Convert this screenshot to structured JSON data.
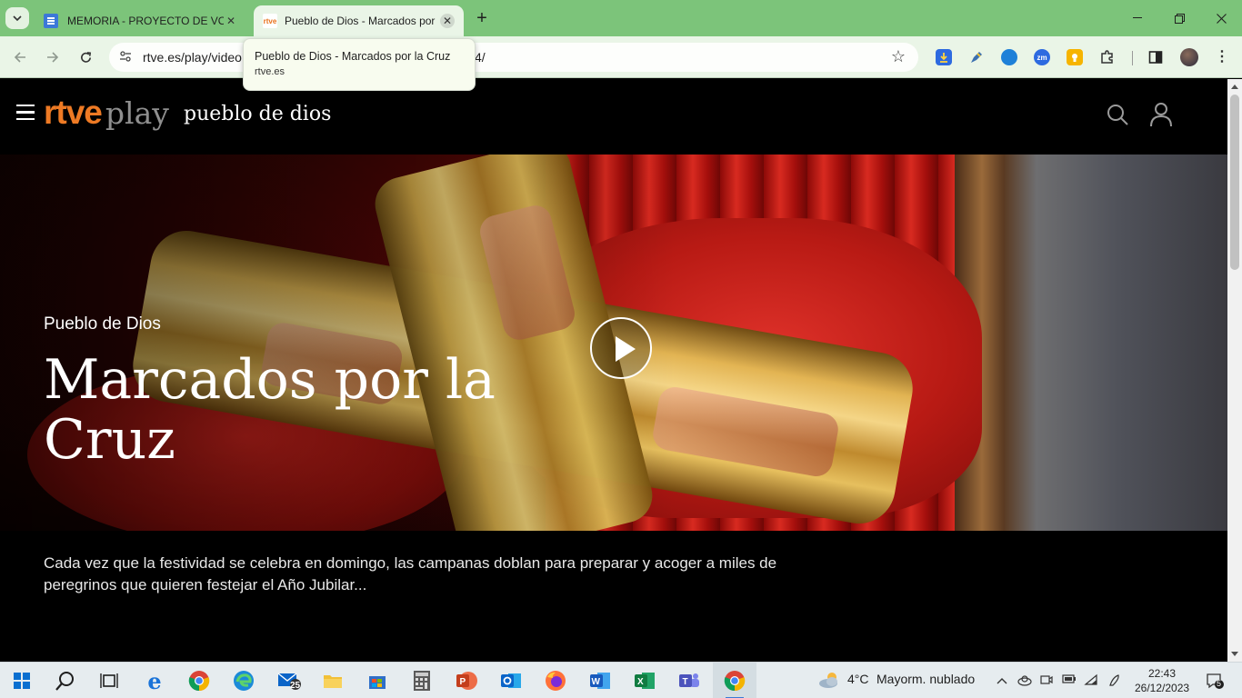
{
  "browser": {
    "tabs": [
      {
        "title": "MEMORIA - PROYECTO DE VOL",
        "favicon": "docs-icon"
      },
      {
        "title": "Pueblo de Dios - Marcados por",
        "favicon": "rtve-icon",
        "favicon_text": "rtve"
      }
    ],
    "url_visible": "rtve.es/play/video",
    "url_tail": "4/",
    "hovercard": {
      "title": "Pueblo de Dios - Marcados por la Cruz",
      "domain": "rtve.es"
    }
  },
  "site": {
    "logo_brand": "rtve",
    "logo_product": "play",
    "section_title": "pueblo de dios",
    "accent_color": "#ee7a24"
  },
  "hero": {
    "program": "Pueblo de Dios",
    "episode_title": "Marcados por la Cruz"
  },
  "description": "Cada vez que la festividad se celebra en domingo, las campanas doblan para preparar y acoger a miles de peregrinos que quieren festejar el Año Jubilar...",
  "taskbar": {
    "mail_badge": "25",
    "weather_temp": "4°C",
    "weather_text": "Mayorm. nublado",
    "time": "22:43",
    "date": "26/12/2023",
    "notifications": "5"
  }
}
